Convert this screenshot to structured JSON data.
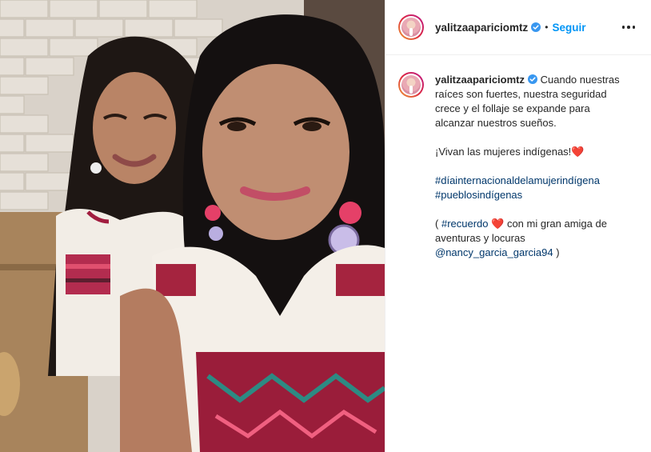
{
  "header": {
    "username": "yalitzaapariciomtz",
    "separator": "•",
    "follow_label": "Seguir",
    "more_icon": "more-horizontal-icon"
  },
  "caption": {
    "username": "yalitzaapariciomtz",
    "line1": "Cuando nuestras raíces son fuertes, nuestra seguridad crece y el follaje se expande para alcanzar nuestros sueños.",
    "line2": "¡Vivan las mujeres indígenas!",
    "line2_emoji": "❤️",
    "hashtag1": "#díainternacionaldelamujerindígena",
    "hashtag2": "#pueblosindígenas",
    "paren_open": "(",
    "hashtag3": "#recuerdo",
    "heart": "❤️",
    "line4_rest": "con mi gran amiga de aventuras y locuras",
    "mention": "@nancy_garcia_garcia94",
    "paren_close": ")"
  },
  "colors": {
    "accent": "#0095f6",
    "link": "#00376b",
    "verified": "#3897f0",
    "heart": "#e0245e"
  }
}
